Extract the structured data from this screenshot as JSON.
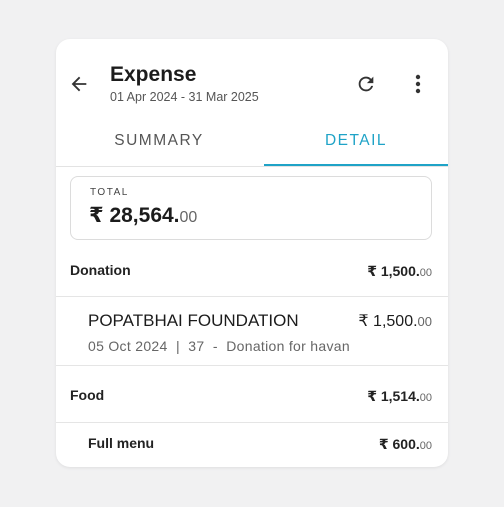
{
  "header": {
    "title": "Expense",
    "date_range": "01 Apr 2024 - 31 Mar 2025",
    "icons": {
      "back": "arrow-left-icon",
      "refresh": "refresh-icon",
      "more": "more-vertical-icon"
    }
  },
  "tabs": [
    {
      "label": "SUMMARY",
      "active": false
    },
    {
      "label": "DETAIL",
      "active": true
    }
  ],
  "total": {
    "label": "TOTAL",
    "amount_main": "₹ 28,564.",
    "amount_decimal": "00"
  },
  "categories": [
    {
      "name": "Donation",
      "amount_main": "₹ 1,500.",
      "amount_decimal": "00",
      "transactions": [
        {
          "payee": "POPATBHAI FOUNDATION",
          "amount_main": "₹ 1,500.",
          "amount_decimal": "00",
          "date": "05 Oct 2024",
          "separator": "|",
          "number": "37",
          "dash": "-",
          "note": "Donation for havan"
        }
      ]
    },
    {
      "name": "Food",
      "amount_main": "₹ 1,514.",
      "amount_decimal": "00",
      "subitems": [
        {
          "name": "Full menu",
          "amount_main": "₹ 600.",
          "amount_decimal": "00"
        }
      ]
    }
  ],
  "colors": {
    "accent": "#1fa3c7",
    "background": "#f1f1f2",
    "card": "#ffffff"
  }
}
